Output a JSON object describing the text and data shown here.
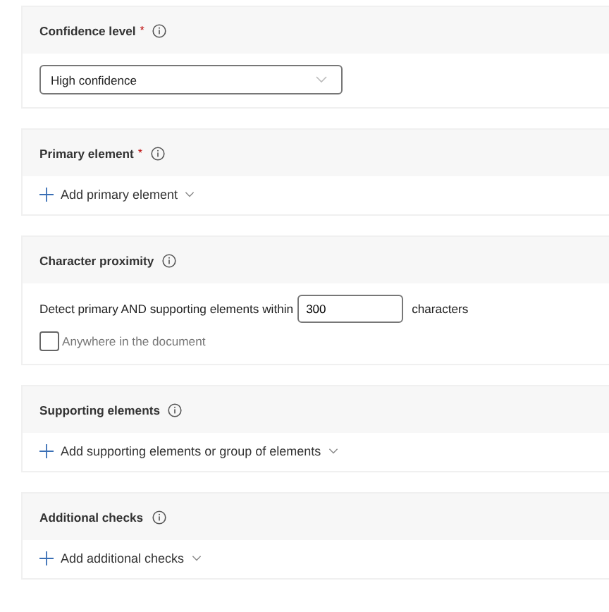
{
  "sections": [
    {
      "kind": "dropdown",
      "title": "Confidence level",
      "required_mark": "*",
      "value": "High confidence"
    },
    {
      "kind": "add",
      "title": "Primary element",
      "required_mark": "*",
      "action": "Add primary element"
    },
    {
      "kind": "proximity",
      "title": "Character proximity",
      "prefix": "Detect primary AND supporting elements within",
      "value": "300",
      "suffix": "characters",
      "checkbox": {
        "label": "Anywhere in the document",
        "checked": false
      }
    },
    {
      "kind": "add",
      "title": "Supporting elements",
      "action": "Add supporting elements or group of elements"
    },
    {
      "kind": "add",
      "title": "Additional checks",
      "action": "Add additional checks"
    }
  ]
}
